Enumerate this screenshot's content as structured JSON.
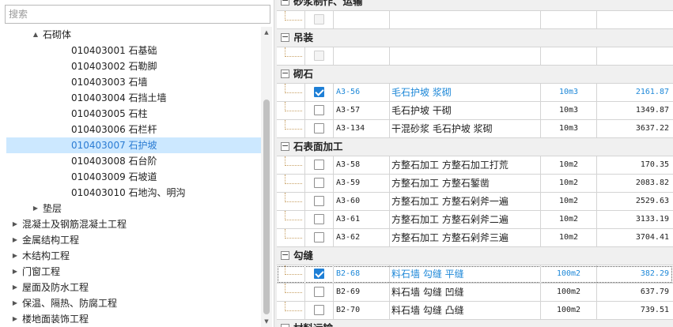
{
  "search": {
    "placeholder": "搜索"
  },
  "tree": {
    "items": [
      {
        "label": "石砌体",
        "arrow": "▲",
        "expanded": true,
        "level": 2,
        "selected": false
      },
      {
        "label": "010403001  石基础",
        "level": 3,
        "selected": false
      },
      {
        "label": "010403002  石勒脚",
        "level": 3,
        "selected": false
      },
      {
        "label": "010403003  石墙",
        "level": 3,
        "selected": false
      },
      {
        "label": "010403004  石挡土墙",
        "level": 3,
        "selected": false
      },
      {
        "label": "010403005  石柱",
        "level": 3,
        "selected": false
      },
      {
        "label": "010403006  石栏杆",
        "level": 3,
        "selected": false
      },
      {
        "label": "010403007  石护坡",
        "level": 3,
        "selected": true
      },
      {
        "label": "010403008  石台阶",
        "level": 3,
        "selected": false
      },
      {
        "label": "010403009  石坡道",
        "level": 3,
        "selected": false
      },
      {
        "label": "010403010  石地沟、明沟",
        "level": 3,
        "selected": false
      },
      {
        "label": "垫层",
        "arrow": "▶",
        "expanded": false,
        "level": 2,
        "selected": false
      },
      {
        "label": "混凝土及钢筋混凝土工程",
        "arrow": "▶",
        "expanded": false,
        "level": 1,
        "selected": false
      },
      {
        "label": "金属结构工程",
        "arrow": "▶",
        "expanded": false,
        "level": 1,
        "selected": false
      },
      {
        "label": "木结构工程",
        "arrow": "▶",
        "expanded": false,
        "level": 1,
        "selected": false
      },
      {
        "label": "门窗工程",
        "arrow": "▶",
        "expanded": false,
        "level": 1,
        "selected": false
      },
      {
        "label": "屋面及防水工程",
        "arrow": "▶",
        "expanded": false,
        "level": 1,
        "selected": false
      },
      {
        "label": "保温、隔热、防腐工程",
        "arrow": "▶",
        "expanded": false,
        "level": 1,
        "selected": false
      },
      {
        "label": "楼地面装饰工程",
        "arrow": "▶",
        "expanded": false,
        "level": 1,
        "selected": false
      }
    ]
  },
  "grid": {
    "rows": [
      {
        "type": "group",
        "name": "砂浆制作、运输",
        "toggle": "−"
      },
      {
        "type": "item",
        "checkbox": "disabled",
        "code": "",
        "name": "",
        "unit": "",
        "price": ""
      },
      {
        "type": "group",
        "name": "吊装",
        "toggle": "−"
      },
      {
        "type": "item",
        "checkbox": "disabled",
        "code": "",
        "name": "",
        "unit": "",
        "price": ""
      },
      {
        "type": "group",
        "name": "砌石",
        "toggle": "−"
      },
      {
        "type": "item",
        "checkbox": "checked",
        "highlight": true,
        "code": "A3-56",
        "name": "毛石护坡 浆砌",
        "unit": "10m3",
        "price": "2161.87"
      },
      {
        "type": "item",
        "checkbox": "unchecked",
        "code": "A3-57",
        "name": "毛石护坡 干砌",
        "unit": "10m3",
        "price": "1349.87"
      },
      {
        "type": "item",
        "checkbox": "unchecked",
        "code": "A3-134",
        "name": "干混砂浆 毛石护坡 浆砌",
        "unit": "10m3",
        "price": "3637.22"
      },
      {
        "type": "group",
        "name": "石表面加工",
        "toggle": "−"
      },
      {
        "type": "item",
        "checkbox": "unchecked",
        "code": "A3-58",
        "name": "方整石加工 方整石加工打荒",
        "unit": "10m2",
        "price": "170.35"
      },
      {
        "type": "item",
        "checkbox": "unchecked",
        "code": "A3-59",
        "name": "方整石加工 方整石錾凿",
        "unit": "10m2",
        "price": "2083.82"
      },
      {
        "type": "item",
        "checkbox": "unchecked",
        "code": "A3-60",
        "name": "方整石加工 方整石剁斧一遍",
        "unit": "10m2",
        "price": "2529.63"
      },
      {
        "type": "item",
        "checkbox": "unchecked",
        "code": "A3-61",
        "name": "方整石加工 方整石剁斧二遍",
        "unit": "10m2",
        "price": "3133.19"
      },
      {
        "type": "item",
        "checkbox": "unchecked",
        "code": "A3-62",
        "name": "方整石加工 方整石剁斧三遍",
        "unit": "10m2",
        "price": "3704.41"
      },
      {
        "type": "group",
        "name": "勾缝",
        "toggle": "−"
      },
      {
        "type": "item",
        "checkbox": "checked",
        "highlight": true,
        "focus": true,
        "code": "B2-68",
        "name": "料石墙 勾缝 平缝",
        "unit": "100m2",
        "price": "382.29"
      },
      {
        "type": "item",
        "checkbox": "unchecked",
        "code": "B2-69",
        "name": "料石墙 勾缝 凹缝",
        "unit": "100m2",
        "price": "637.79"
      },
      {
        "type": "item",
        "checkbox": "unchecked",
        "code": "B2-70",
        "name": "料石墙 勾缝 凸缝",
        "unit": "100m2",
        "price": "739.51"
      },
      {
        "type": "group",
        "name": "材料运输",
        "toggle": "−"
      }
    ]
  },
  "scrollbar": {
    "up_arrow": "▲",
    "down_arrow": "▼"
  },
  "colors": {
    "selection_bg": "#cce8ff",
    "highlight_text": "#1e88d8",
    "checkbox_checked": "#1e7fd6",
    "group_bg": "#f0f0f0"
  }
}
